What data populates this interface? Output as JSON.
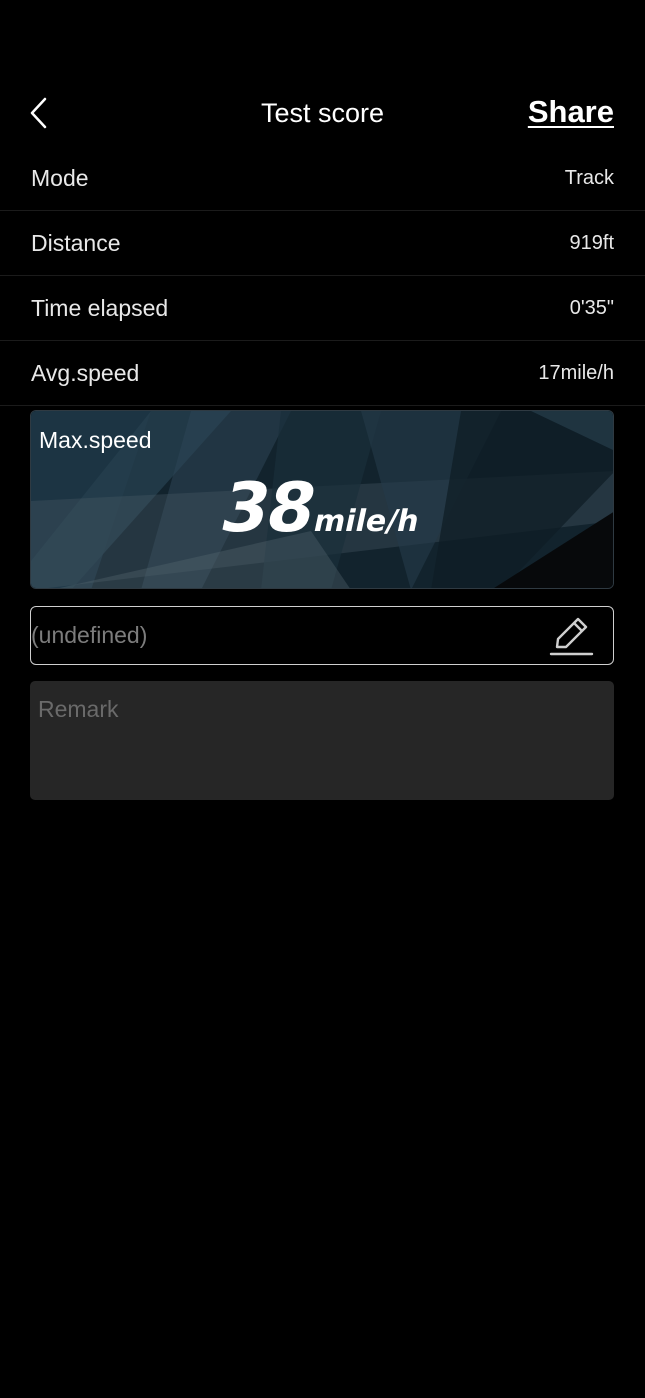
{
  "header": {
    "title": "Test score",
    "share_label": "Share",
    "back_icon": "chevron-left-icon"
  },
  "stats": [
    {
      "label": "Mode",
      "value": "Track"
    },
    {
      "label": "Distance",
      "value": "919ft"
    },
    {
      "label": "Time elapsed",
      "value": "0'35\""
    },
    {
      "label": "Avg.speed",
      "value": "17mile/h"
    }
  ],
  "max_speed": {
    "label": "Max.speed",
    "value": "38",
    "unit": "mile/h"
  },
  "name_field": {
    "value": "(undefined)",
    "edit_icon": "pencil-icon"
  },
  "remark": {
    "placeholder": "Remark"
  },
  "colors": {
    "background": "#000000",
    "card_accent": "#1f3a4a",
    "remark_bg": "#262626"
  }
}
